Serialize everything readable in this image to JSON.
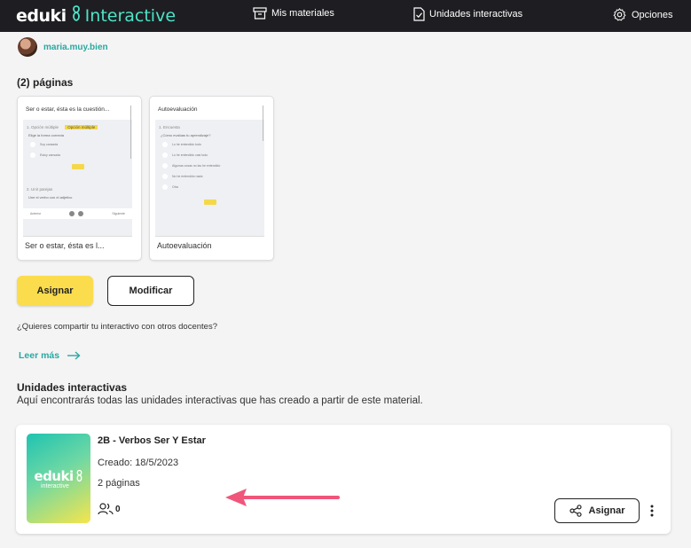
{
  "header": {
    "logo_eduki": "eduki",
    "logo_interactive": "Interactive",
    "nav": [
      {
        "label": "Mis materiales",
        "icon": "archive-box-icon"
      },
      {
        "label": "Unidades interactivas",
        "icon": "document-check-icon"
      },
      {
        "label": "Opciones",
        "icon": "gear-icon"
      }
    ]
  },
  "user": {
    "name": "maria.muy.bien"
  },
  "pages": {
    "title": "(2) páginas",
    "items": [
      {
        "label": "Ser o estar, ésta es l...",
        "preview_title": "Ser o estar, ésta es la cuestión...",
        "preview_section1": "1. Opción múltiple",
        "preview_tag": "Opción múltiple",
        "preview_q": "Elige la forma correcta",
        "preview_opts": [
          "Soy cansada",
          "Estoy cansada"
        ],
        "preview_section2": "2. Unir parejas",
        "preview_q2": "Une el verbo con el adjetivo",
        "preview_footer_left": "Anterior",
        "preview_footer_right": "Siguiente"
      },
      {
        "label": "Autoevaluación",
        "preview_title": "Autoevaluación",
        "preview_section1": "1. Encuesta",
        "preview_q": "¿Cómo evalúas tu aprendizaje?",
        "preview_opts": [
          "Lo he entendido todo",
          "Lo he entendido casi todo",
          "Algunas cosas no las he entendido",
          "No he entendido nada",
          "Otra"
        ]
      }
    ]
  },
  "actions": {
    "assign": "Asignar",
    "modify": "Modificar"
  },
  "share": {
    "question": "¿Quieres compartir tu interactivo con otros docentes?",
    "read_more": "Leer más"
  },
  "units": {
    "title": "Unidades interactivas",
    "description": "Aquí encontrarás todas las unidades interactivas que has creado a partir de este material.",
    "items": [
      {
        "name": "2B - Verbos Ser Y Estar",
        "created": "Creado: 18/5/2023",
        "pages": "2 páginas",
        "users": "0",
        "assign": "Asignar",
        "thumb_eduki": "eduki",
        "thumb_interactive": "interactive"
      }
    ]
  },
  "colors": {
    "accent": "#2aa8a0",
    "yellow": "#fbdc4d",
    "annotation_arrow": "#f0567a",
    "topbar": "#1e1e22"
  }
}
